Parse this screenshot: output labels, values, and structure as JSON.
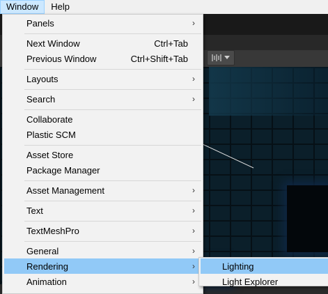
{
  "menubar": {
    "items": [
      "Window",
      "Help"
    ]
  },
  "window_menu": {
    "panels": "Panels",
    "next_window": "Next Window",
    "next_window_shortcut": "Ctrl+Tab",
    "previous_window": "Previous Window",
    "previous_window_shortcut": "Ctrl+Shift+Tab",
    "layouts": "Layouts",
    "search": "Search",
    "collaborate": "Collaborate",
    "plastic_scm": "Plastic SCM",
    "asset_store": "Asset Store",
    "package_manager": "Package Manager",
    "asset_management": "Asset Management",
    "text": "Text",
    "textmeshpro": "TextMeshPro",
    "general": "General",
    "rendering": "Rendering",
    "animation": "Animation",
    "submenu_arrow": "›"
  },
  "rendering_submenu": {
    "lighting": "Lighting",
    "light_explorer": "Light Explorer"
  },
  "colors": {
    "menu_bg": "#f2f2f2",
    "highlight": "#91c9f7",
    "active_menubar": "#cce8ff"
  },
  "icons": {
    "gizmo": "gizmo-toggle-icon",
    "dropdown": "triangle-down-icon"
  }
}
